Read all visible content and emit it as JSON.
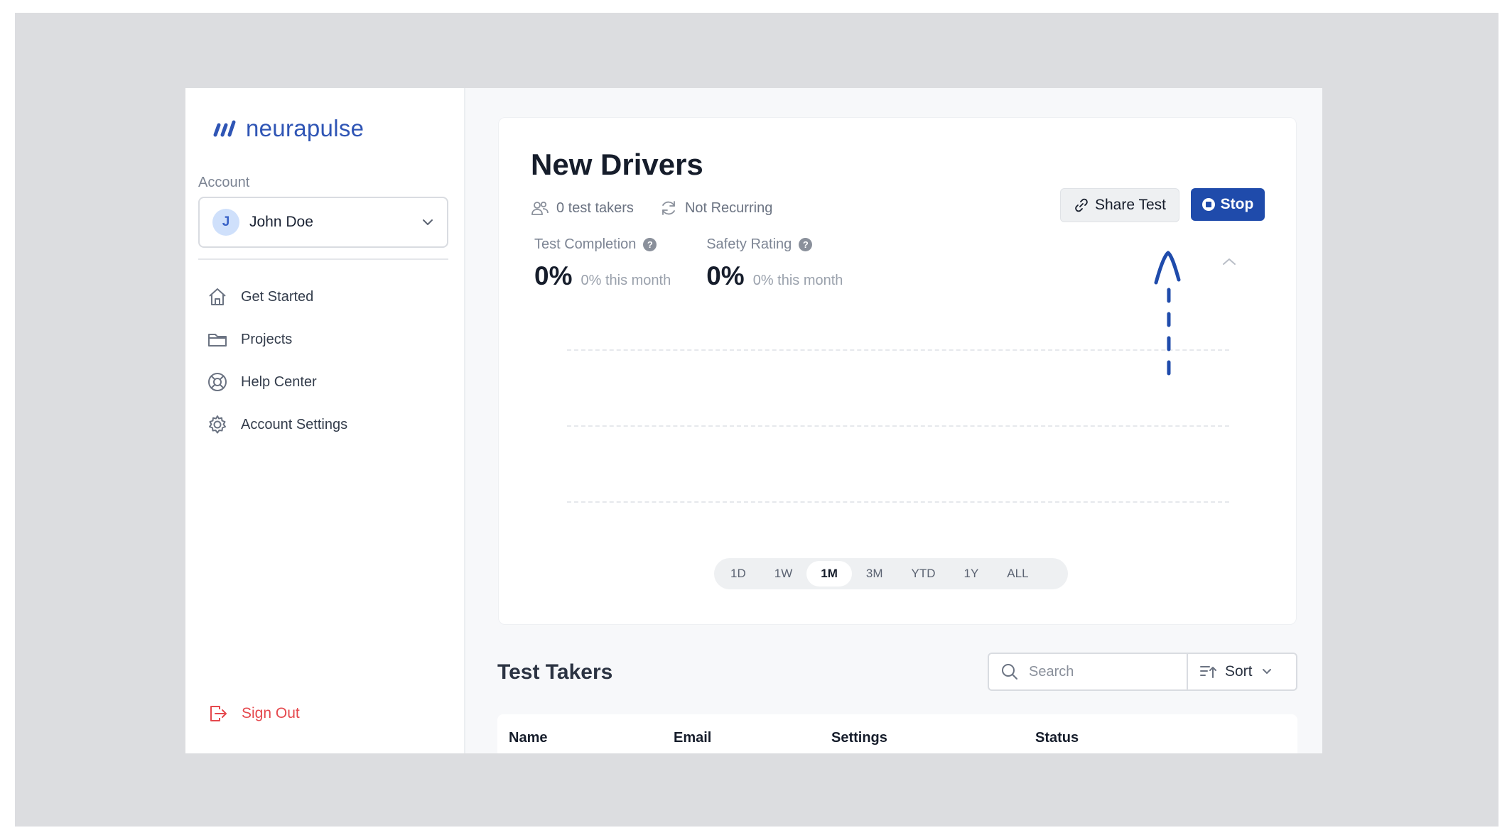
{
  "brand": {
    "name": "neurapulse",
    "color": "#2f55b5"
  },
  "sidebar": {
    "account_label": "Account",
    "account": {
      "initial": "J",
      "name": "John Doe"
    },
    "items": [
      {
        "label": "Get Started",
        "icon": "home-icon"
      },
      {
        "label": "Projects",
        "icon": "folder-icon"
      },
      {
        "label": "Help Center",
        "icon": "lifebuoy-icon"
      },
      {
        "label": "Account Settings",
        "icon": "gear-icon"
      }
    ],
    "sign_out": "Sign Out"
  },
  "test": {
    "title": "New Drivers",
    "takers": "0 test takers",
    "recurrence": "Not Recurring",
    "share_label": "Share Test",
    "stop_label": "Stop",
    "stats": [
      {
        "label": "Test Completion",
        "value": "0%",
        "sub": "0% this month"
      },
      {
        "label": "Safety Rating",
        "value": "0%",
        "sub": "0% this month"
      }
    ],
    "ranges": [
      "1D",
      "1W",
      "1M",
      "3M",
      "YTD",
      "1Y",
      "ALL"
    ],
    "active_range": "1M"
  },
  "takers": {
    "title": "Test Takers",
    "search_placeholder": "Search",
    "sort_label": "Sort",
    "columns": [
      "Name",
      "Email",
      "Settings",
      "Status"
    ]
  },
  "colors": {
    "accent": "#1f4bab",
    "danger": "#e5484d"
  }
}
